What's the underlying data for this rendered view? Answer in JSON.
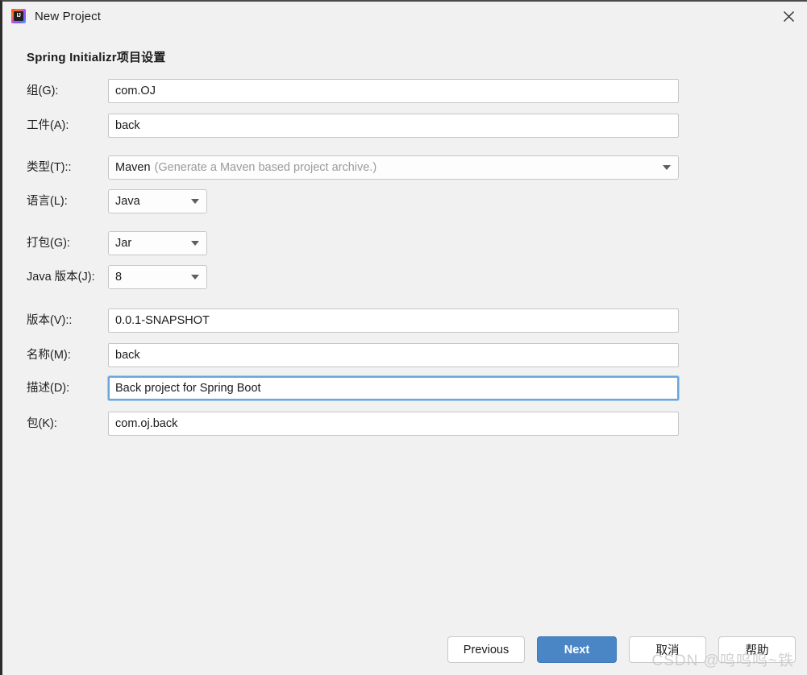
{
  "window": {
    "title": "New Project",
    "close_icon": "close-icon",
    "app_icon": "intellij-idea-icon"
  },
  "heading": "Spring Initializr项目设置",
  "form": {
    "rows": [
      {
        "label": "组(G):",
        "kind": "text",
        "value": "com.OJ",
        "focused": false
      },
      {
        "label": "工件(A):",
        "kind": "text",
        "value": "back",
        "focused": false
      },
      {
        "label": "类型(T)::",
        "kind": "combo_wide",
        "value": "Maven",
        "hint": "(Generate a Maven based project archive.)"
      },
      {
        "label": "语言(L):",
        "kind": "combo_narrow",
        "value": "Java"
      },
      {
        "label": "打包(G):",
        "kind": "combo_narrow",
        "value": "Jar"
      },
      {
        "label": "Java 版本(J):",
        "kind": "combo_narrow",
        "value": "8"
      },
      {
        "label": "版本(V)::",
        "kind": "text",
        "value": "0.0.1-SNAPSHOT",
        "focused": false
      },
      {
        "label": "名称(M):",
        "kind": "text",
        "value": "back",
        "focused": false
      },
      {
        "label": "描述(D):",
        "kind": "text",
        "value": "Back project for Spring Boot",
        "focused": true
      },
      {
        "label": "包(K):",
        "kind": "text",
        "value": "com.oj.back",
        "focused": false
      }
    ]
  },
  "footer": {
    "previous_label": "Previous",
    "next_label": "Next",
    "cancel_label": "取消",
    "help_label": "帮助"
  },
  "watermark": "CSDN @呜呜呜~铁",
  "colors": {
    "background": "#f1f1f1",
    "primary_button": "#4a86c5",
    "focus_border": "#6aa5db",
    "field_border": "#c6c6c6",
    "text": "#1b1b1b",
    "hint_text": "#9b9b9b"
  }
}
